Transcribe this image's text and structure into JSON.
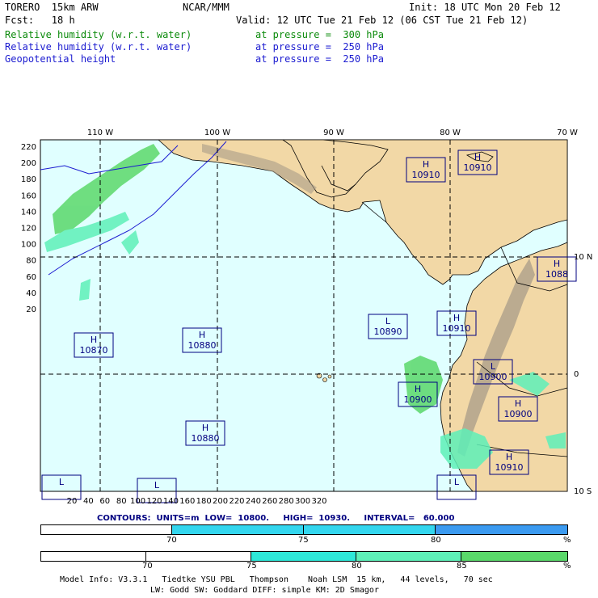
{
  "header": {
    "model": "TORERO  15km ARW",
    "org": "NCAR/MMM",
    "init": "Init: 18 UTC Mon 20 Feb 12",
    "fcst": "Fcst:   18 h",
    "valid": "Valid: 12 UTC Tue 21 Feb 12 (06 CST Tue 21 Feb 12)",
    "fields": [
      {
        "name": "Relative humidity (w.r.t. water)",
        "level": "at pressure =  300 hPa",
        "color": "#0a8a0a"
      },
      {
        "name": "Relative humidity (w.r.t. water)",
        "level": "at pressure =  250 hPa",
        "color": "#1a1ad0"
      },
      {
        "name": "Geopotential height",
        "level": "at pressure =  250 hPa",
        "color": "#1a1ad0"
      }
    ]
  },
  "map": {
    "top_lon_labels": [
      "110 W",
      "100 W",
      "90 W",
      "80 W",
      "70 W"
    ],
    "right_lat_labels": [
      "10 N",
      "0",
      "10 S"
    ],
    "left_ticks": [
      "220",
      "200",
      "180",
      "160",
      "140",
      "120",
      "100",
      "80",
      "60",
      "40",
      "20"
    ],
    "bottom_ticks": [
      "20",
      "40",
      "60",
      "80",
      "100",
      "120",
      "140",
      "160",
      "180",
      "200",
      "220",
      "240",
      "260",
      "280",
      "300",
      "320"
    ],
    "centers": [
      {
        "type": "H",
        "value": "10910"
      },
      {
        "type": "H",
        "value": "10910"
      },
      {
        "type": "H",
        "value": "10870"
      },
      {
        "type": "H",
        "value": "10880"
      },
      {
        "type": "L",
        "value": "10890"
      },
      {
        "type": "H",
        "value": "10910"
      },
      {
        "type": "L",
        "value": "10900"
      },
      {
        "type": "H",
        "value": "10900"
      },
      {
        "type": "H",
        "value": "10900"
      },
      {
        "type": "H",
        "value": "10880"
      },
      {
        "type": "H",
        "value": "10910"
      },
      {
        "type": "H",
        "value": "1088"
      },
      {
        "type": "L",
        "value": ""
      },
      {
        "type": "L",
        "value": ""
      },
      {
        "type": "L",
        "value": ""
      }
    ],
    "colors": {
      "ocean": "#e0ffff",
      "land": "#f2d8a6",
      "terrain": "#a89c88",
      "grid": "#000000",
      "center_box": "#000080"
    }
  },
  "contours": {
    "label": "CONTOURS:  UNITS=m  LOW=  10800.     HIGH=  10930.     INTERVAL=   60.000"
  },
  "colorbar1": {
    "ticks": [
      "70",
      "75",
      "80",
      "%"
    ],
    "colors": [
      "#ffffff",
      "#ffffff",
      "#33d6ee",
      "#33d6ee",
      "#3b9af0"
    ]
  },
  "colorbar2": {
    "ticks": [
      "70",
      "75",
      "80",
      "85",
      "%"
    ],
    "colors": [
      "#ffffff",
      "#ffffff",
      "#2ee8d8",
      "#5ef0b8",
      "#5ad86a"
    ]
  },
  "footer": {
    "line1": "Model Info: V3.3.1   Tiedtke YSU PBL   Thompson    Noah LSM  15 km,   44 levels,   70 sec",
    "line2": "LW: Godd SW: Goddard DIFF: simple KM: 2D Smagor"
  }
}
